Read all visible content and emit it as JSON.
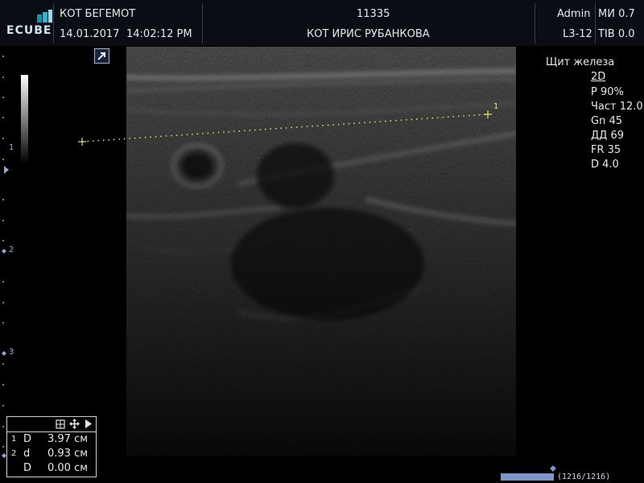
{
  "header": {
    "patient_name": "КОТ БЕГЕМОТ",
    "date": "14.01.2017",
    "time": "14:02:12 PM",
    "patient_id": "11335",
    "owner": "КОТ ИРИС РУБАНКОВА",
    "user": "Admin",
    "mi": "МИ 0.7",
    "probe": "L3-12",
    "tib": "TIB 0.0",
    "logo": "ECUBE"
  },
  "params": {
    "preset": "Щит железа",
    "mode": "2D",
    "power": "P 90%",
    "freq": "Част 12.0",
    "gain": "Gn 45",
    "dr": "ДД 69",
    "fr": "FR 35",
    "depth": "D 4.0"
  },
  "depth_scale": {
    "marks": [
      "1",
      "2",
      "3"
    ]
  },
  "caliper": {
    "label": "1"
  },
  "measurements": [
    {
      "index": "1",
      "label": "D",
      "value": "3.97 см"
    },
    {
      "index": "2",
      "label": "d",
      "value": "0.93 см"
    },
    {
      "index": "",
      "label": "D",
      "value": "0.00 см"
    }
  ],
  "cine": {
    "counter": "(1216/1216)",
    "progress": 1.0
  }
}
